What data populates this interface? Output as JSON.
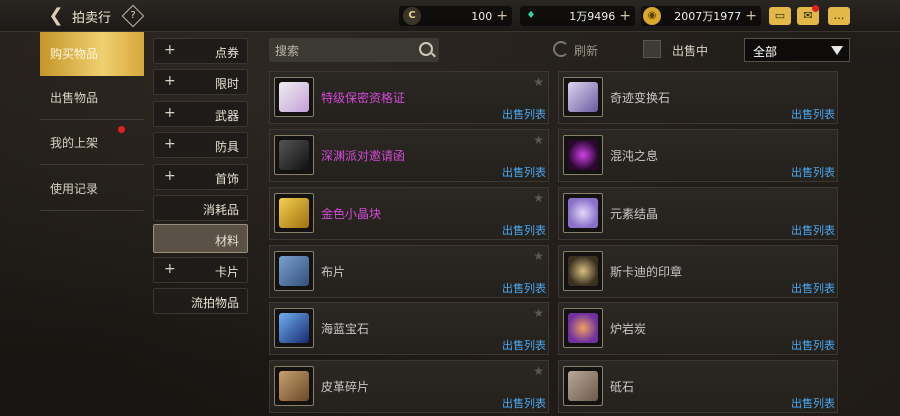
{
  "header": {
    "title": "拍卖行",
    "help": "?",
    "back_icon": "back-arrow-icon"
  },
  "currencies": [
    {
      "icon": "c-coin-icon",
      "value": "100",
      "plus": "+"
    },
    {
      "icon": "gem-icon",
      "value": "1万9496",
      "plus": "+"
    },
    {
      "icon": "gold-icon",
      "value": "2007万1977",
      "plus": "+"
    }
  ],
  "top_icons": {
    "mail": "✉",
    "chat": "…"
  },
  "nav": {
    "items": [
      {
        "label": "购买物品"
      },
      {
        "label": "出售物品"
      },
      {
        "label": "我的上架"
      },
      {
        "label": "使用记录"
      }
    ]
  },
  "categories": [
    {
      "label": "点券",
      "plus": "+"
    },
    {
      "label": "限时",
      "plus": "+"
    },
    {
      "label": "武器",
      "plus": "+"
    },
    {
      "label": "防具",
      "plus": "+"
    },
    {
      "label": "首饰",
      "plus": "+"
    },
    {
      "label": "消耗品",
      "plus": ""
    },
    {
      "label": "材料",
      "plus": ""
    },
    {
      "label": "卡片",
      "plus": "+"
    },
    {
      "label": "流拍物品",
      "plus": ""
    }
  ],
  "search": {
    "placeholder": "搜索"
  },
  "refresh": {
    "label": "刷新"
  },
  "selling_toggle": {
    "label": "出售中"
  },
  "filter": {
    "value": "全部"
  },
  "items": [
    {
      "name": "特级保密资格证",
      "color": "#d24ad6",
      "link": "出售列表",
      "icon": "certificate-icon"
    },
    {
      "name": "奇迹变换石",
      "color": "#c8c8c8",
      "link": "出售列表",
      "icon": "crystal-icon"
    },
    {
      "name": "深渊派对邀请函",
      "color": "#d24ad6",
      "link": "出售列表",
      "icon": "invitation-icon"
    },
    {
      "name": "混沌之息",
      "color": "#c8c8c8",
      "link": "出售列表",
      "icon": "chaos-icon"
    },
    {
      "name": "金色小晶块",
      "color": "#d24ad6",
      "link": "出售列表",
      "icon": "gold-cube-icon"
    },
    {
      "name": "元素结晶",
      "color": "#c8c8c8",
      "link": "出售列表",
      "icon": "element-crystal-icon"
    },
    {
      "name": "布片",
      "color": "#c8c8c8",
      "link": "出售列表",
      "icon": "cloth-icon"
    },
    {
      "name": "斯卡迪的印章",
      "color": "#c8c8c8",
      "link": "出售列表",
      "icon": "seal-icon"
    },
    {
      "name": "海蓝宝石",
      "color": "#c8c8c8",
      "link": "出售列表",
      "icon": "sapphire-icon"
    },
    {
      "name": "炉岩炭",
      "color": "#c8c8c8",
      "link": "出售列表",
      "icon": "charcoal-icon"
    },
    {
      "name": "皮革碎片",
      "color": "#c8c8c8",
      "link": "出售列表",
      "icon": "leather-icon"
    },
    {
      "name": "砥石",
      "color": "#c8c8c8",
      "link": "出售列表",
      "icon": "whetstone-icon"
    }
  ]
}
